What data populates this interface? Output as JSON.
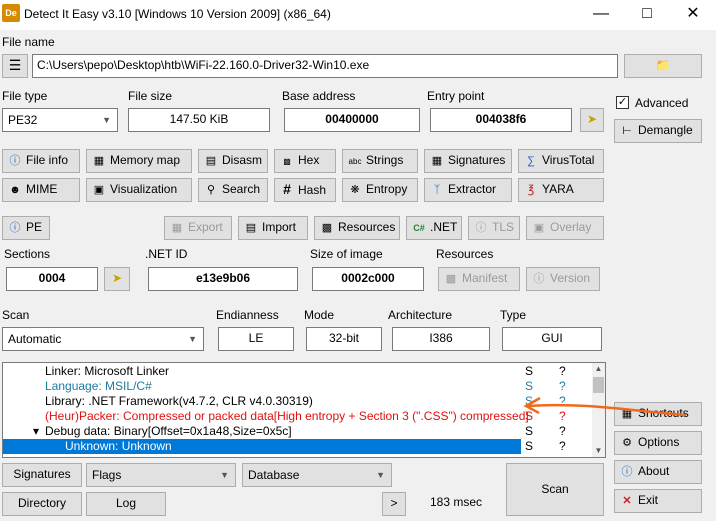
{
  "window": {
    "title": "Detect It Easy v3.10 [Windows 10 Version 2009] (x86_64)",
    "icon_text": "De"
  },
  "file": {
    "label": "File name",
    "path": "C:\\Users\\pepo\\Desktop\\htb\\WiFi-22.160.0-Driver32-Win10.exe"
  },
  "info": {
    "file_type_label": "File type",
    "file_type": "PE32",
    "file_size_label": "File size",
    "file_size": "147.50 KiB",
    "base_address_label": "Base address",
    "base_address": "00400000",
    "entry_point_label": "Entry point",
    "entry_point": "004038f6"
  },
  "tools": {
    "file_info": "File info",
    "memory_map": "Memory map",
    "disasm": "Disasm",
    "hex": "Hex",
    "strings": "Strings",
    "signatures": "Signatures",
    "virustotal": "VirusTotal",
    "mime": "MIME",
    "visualization": "Visualization",
    "search": "Search",
    "hash": "Hash",
    "entropy": "Entropy",
    "extractor": "Extractor",
    "yara": "YARA"
  },
  "pe": {
    "pe": "PE",
    "export": "Export",
    "import": "Import",
    "resources": "Resources",
    "net": ".NET",
    "tls": "TLS",
    "overlay": "Overlay",
    "sections_label": "Sections",
    "sections": "0004",
    "net_id_label": ".NET ID",
    "net_id": "e13e9b06",
    "size_of_image_label": "Size of image",
    "size_of_image": "0002c000",
    "resources_label": "Resources",
    "manifest": "Manifest",
    "version": "Version"
  },
  "scan": {
    "scan_label": "Scan",
    "scan_mode": "Automatic",
    "endianness_label": "Endianness",
    "endianness": "LE",
    "mode_label": "Mode",
    "mode": "32-bit",
    "architecture_label": "Architecture",
    "architecture": "I386",
    "type_label": "Type",
    "type": "GUI"
  },
  "results": [
    {
      "text": "Linker: Microsoft Linker",
      "c1": "S",
      "c2": "?"
    },
    {
      "text": "Language: MSIL/C#",
      "c1": "S",
      "c2": "?"
    },
    {
      "text": "Library: .NET Framework(v4.7.2, CLR v4.0.30319)",
      "c1": "S",
      "c2": "?"
    },
    {
      "text": "(Heur)Packer: Compressed or packed data[High entropy + Section 3 (\".CSS\") compressed]",
      "c1": "S",
      "c2": "?"
    },
    {
      "text": "Debug data: Binary[Offset=0x1a48,Size=0x5c]",
      "c1": "S",
      "c2": "?"
    },
    {
      "text": "Unknown: Unknown",
      "c1": "S",
      "c2": "?"
    }
  ],
  "bottom": {
    "signatures": "Signatures",
    "flags": "Flags",
    "database": "Database",
    "directory": "Directory",
    "log": "Log",
    "more": ">",
    "time": "183 msec",
    "scan": "Scan"
  },
  "side": {
    "advanced": "Advanced",
    "demangle": "Demangle",
    "shortcuts": "Shortcuts",
    "options": "Options",
    "about": "About",
    "exit": "Exit"
  },
  "colors": {
    "accent": "#0078d7",
    "heur_text": "#e01010",
    "info_text": "#1f7a9e",
    "annotation_arrow": "#f06a1e"
  }
}
